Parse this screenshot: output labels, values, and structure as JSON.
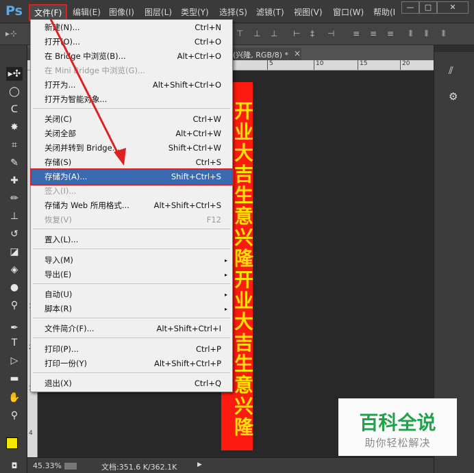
{
  "app": {
    "logo": "Ps"
  },
  "menubar": {
    "items": [
      "文件(F)",
      "编辑(E)",
      "图像(I)",
      "图层(L)",
      "类型(Y)",
      "选择(S)",
      "滤镜(T)",
      "视图(V)",
      "窗口(W)",
      "帮助(I"
    ],
    "window_buttons": [
      "—",
      "□",
      "✕"
    ]
  },
  "document": {
    "tab_title": "(兴隆, RGB/8) *",
    "tab_close": "×",
    "ruler_top": [
      "5",
      "10",
      "15",
      "20"
    ],
    "ruler_left": [
      "1",
      "2",
      "3",
      "4"
    ],
    "banner_text": "开业大吉生意兴隆开业大吉生意兴隆"
  },
  "status": {
    "zoom": "45.33%",
    "doc_info": "文档:351.6 K/362.1K"
  },
  "file_menu": {
    "items": [
      {
        "label": "新建(N)...",
        "shortcut": "Ctrl+N"
      },
      {
        "label": "打开(O)...",
        "shortcut": "Ctrl+O"
      },
      {
        "label": "在 Bridge 中浏览(B)...",
        "shortcut": "Alt+Ctrl+O"
      },
      {
        "label": "在 Mini Bridge 中浏览(G)...",
        "shortcut": "",
        "disabled": true
      },
      {
        "label": "打开为...",
        "shortcut": "Alt+Shift+Ctrl+O"
      },
      {
        "label": "打开为智能对象...",
        "shortcut": ""
      },
      {
        "label": "关闭(C)",
        "shortcut": "Ctrl+W"
      },
      {
        "label": "关闭全部",
        "shortcut": "Alt+Ctrl+W"
      },
      {
        "label": "关闭并转到 Bridge...",
        "shortcut": "Shift+Ctrl+W"
      },
      {
        "label": "存储(S)",
        "shortcut": "Ctrl+S"
      },
      {
        "label": "存储为(A)...",
        "shortcut": "Shift+Ctrl+S"
      },
      {
        "label": "签入(I)...",
        "shortcut": "",
        "disabled": true
      },
      {
        "label": "存储为 Web 所用格式...",
        "shortcut": "Alt+Shift+Ctrl+S"
      },
      {
        "label": "恢复(V)",
        "shortcut": "F12",
        "disabled": true
      },
      {
        "label": "置入(L)...",
        "shortcut": ""
      },
      {
        "label": "导入(M)",
        "shortcut": ""
      },
      {
        "label": "导出(E)",
        "shortcut": ""
      },
      {
        "label": "自动(U)",
        "shortcut": ""
      },
      {
        "label": "脚本(R)",
        "shortcut": ""
      },
      {
        "label": "文件简介(F)...",
        "shortcut": "Alt+Shift+Ctrl+I"
      },
      {
        "label": "打印(P)...",
        "shortcut": "Ctrl+P"
      },
      {
        "label": "打印一份(Y)",
        "shortcut": "Alt+Shift+Ctrl+P"
      },
      {
        "label": "退出(X)",
        "shortcut": "Ctrl+Q"
      }
    ],
    "submenu_arrow": "▸"
  },
  "watermark": {
    "title": "百科全说",
    "subtitle": "助你轻松解决"
  },
  "colors": {
    "banner_bg": "#ff1a0f",
    "banner_text": "#ffe000",
    "highlight": "#3a6ab0",
    "annotation": "#e02020",
    "watermark_green": "#1fa34a"
  }
}
